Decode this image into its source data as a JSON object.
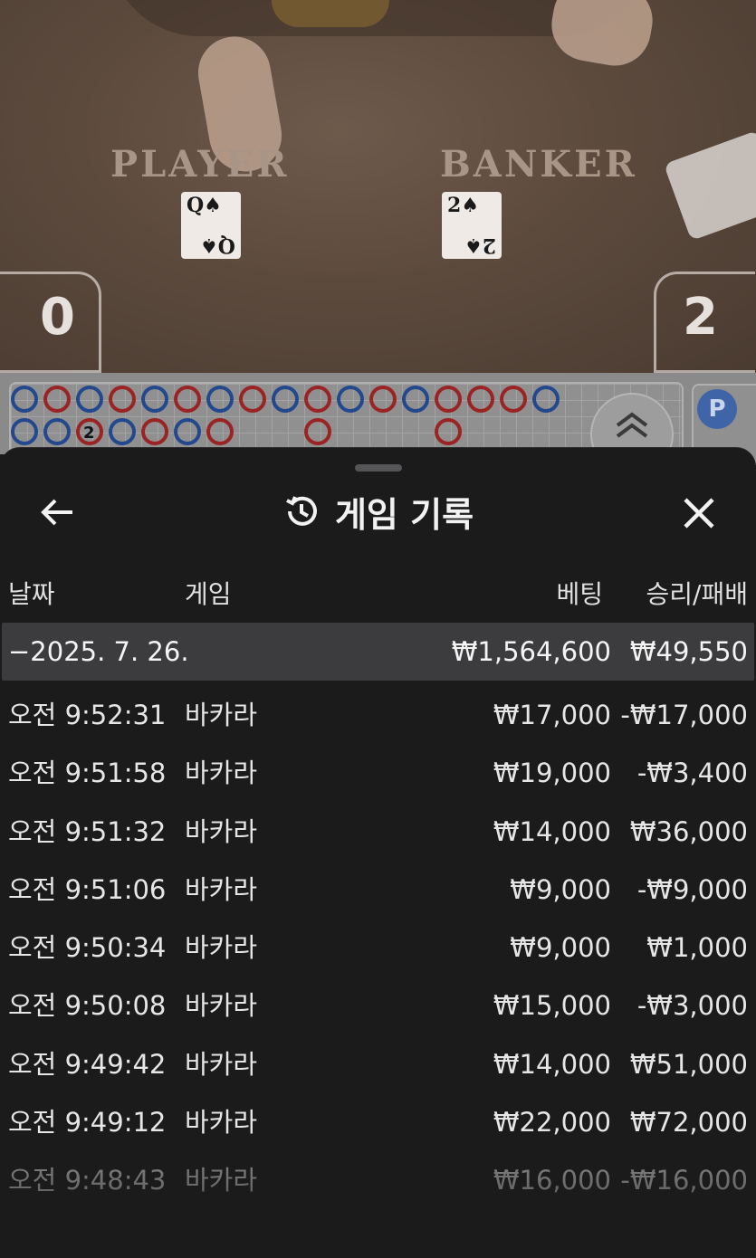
{
  "video": {
    "player_label": "PLAYER",
    "banker_label": "BANKER",
    "player_score": "0",
    "banker_score": "2",
    "player_card_rank": "Q",
    "banker_card_rank": "2",
    "card_suit": "♠"
  },
  "road": {
    "side_chip": "P",
    "expand_icon": "chevrons-up-icon",
    "beads_row1": [
      "P",
      "B",
      "P",
      "B",
      "P",
      "B",
      "P",
      "B",
      "P",
      "B",
      "P",
      "B",
      "P",
      "B",
      "B",
      "B",
      "P"
    ],
    "beads_row2": [
      "P",
      "P",
      "B",
      "P",
      "B",
      "P",
      "B",
      "",
      "",
      "B",
      "",
      "",
      "",
      "B"
    ],
    "tie_marker_count": "2"
  },
  "sheet": {
    "title": "게임 기록",
    "title_icon": "history-icon",
    "back_icon": "arrow-left-icon",
    "close_icon": "close-icon"
  },
  "columns": {
    "date": "날짜",
    "game": "게임",
    "bet": "베팅",
    "result": "승리/패배"
  },
  "summary": {
    "date": "−2025. 7. 26.",
    "bet": "₩1,564,600",
    "result": "₩49,550"
  },
  "rows": [
    {
      "time": "오전 9:52:31",
      "game": "바카라",
      "bet": "₩17,000",
      "result": "-₩17,000"
    },
    {
      "time": "오전 9:51:58",
      "game": "바카라",
      "bet": "₩19,000",
      "result": "-₩3,400"
    },
    {
      "time": "오전 9:51:32",
      "game": "바카라",
      "bet": "₩14,000",
      "result": "₩36,000"
    },
    {
      "time": "오전 9:51:06",
      "game": "바카라",
      "bet": "₩9,000",
      "result": "-₩9,000"
    },
    {
      "time": "오전 9:50:34",
      "game": "바카라",
      "bet": "₩9,000",
      "result": "₩1,000"
    },
    {
      "time": "오전 9:50:08",
      "game": "바카라",
      "bet": "₩15,000",
      "result": "-₩3,000"
    },
    {
      "time": "오전 9:49:42",
      "game": "바카라",
      "bet": "₩14,000",
      "result": "₩51,000"
    },
    {
      "time": "오전 9:49:12",
      "game": "바카라",
      "bet": "₩22,000",
      "result": "₩72,000"
    },
    {
      "time": "오전 9:48:43",
      "game": "바카라",
      "bet": "₩16,000",
      "result": "-₩16,000"
    }
  ]
}
